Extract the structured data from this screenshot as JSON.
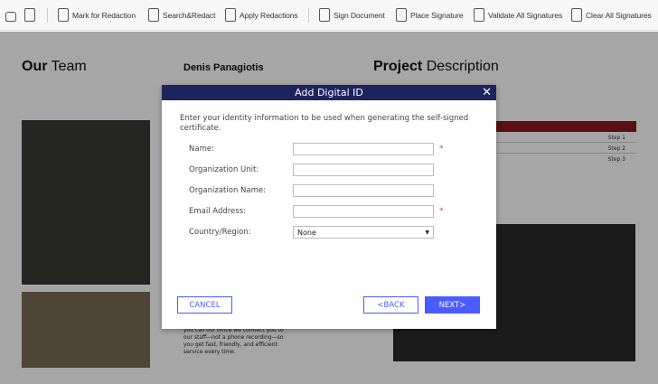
{
  "toolbar": {
    "items": [
      {
        "label": "Mark for Redaction"
      },
      {
        "label": "Search&Redact"
      },
      {
        "label": "Apply Redactions"
      },
      {
        "label": "Sign Document"
      },
      {
        "label": "Place Signature"
      },
      {
        "label": "Validate All Signatures"
      },
      {
        "label": "Clear All Signatures"
      }
    ]
  },
  "document": {
    "our_team_bold": "Our",
    "our_team_rest": "Team",
    "person_name": "Denis Panagiotis",
    "project_bold": "Project",
    "project_rest": "Description",
    "steps": [
      "Step 1",
      "Step 2",
      "Step 3"
    ],
    "body_text": "you call our office we connect you to our staff—not a phone recording—so you get fast, friendly, and efficient service every time.",
    "accent": "#8b1a1a"
  },
  "dialog": {
    "title": "Add Digital ID",
    "intro": "Enter your identity information to be used when generating the self-signed certificate.",
    "fields": [
      {
        "label": "Name:",
        "value": "",
        "required": true
      },
      {
        "label": "Organization Unit:",
        "value": ""
      },
      {
        "label": "Organization Name:",
        "value": ""
      },
      {
        "label": "Email Address:",
        "value": "",
        "required": true
      }
    ],
    "country_label": "Country/Region:",
    "country_value": "None",
    "required_mark": "*",
    "cancel": "CANCEL",
    "back": "<BACK",
    "next": "NEXT>",
    "accent": "#4a5cff"
  }
}
